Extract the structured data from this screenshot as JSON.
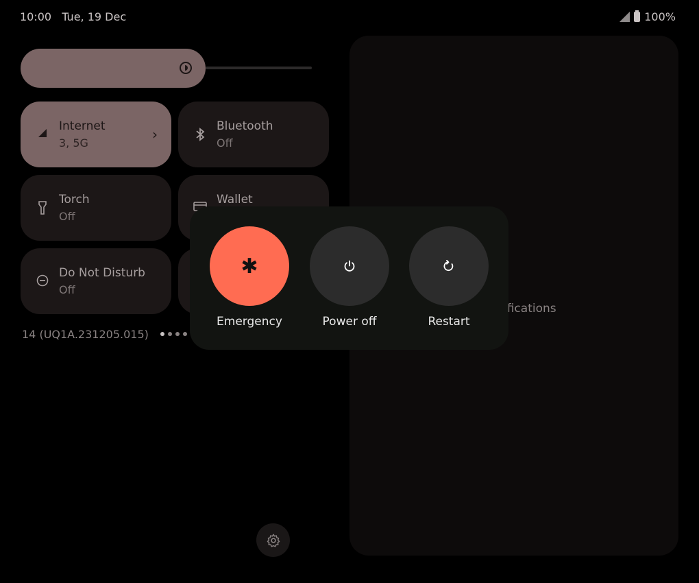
{
  "status_bar": {
    "time": "10:00",
    "date": "Tue, 19 Dec",
    "battery": "100%"
  },
  "tiles": [
    {
      "title": "Internet",
      "subtitle": "3, 5G",
      "icon": "signal-icon",
      "active": true
    },
    {
      "title": "Bluetooth",
      "subtitle": "Off",
      "icon": "bluetooth-icon",
      "active": false
    },
    {
      "title": "Torch",
      "subtitle": "Off",
      "icon": "torch-icon",
      "active": false
    },
    {
      "title": "Wallet",
      "subtitle": "",
      "icon": "wallet-icon",
      "active": false
    },
    {
      "title": "Do Not Disturb",
      "subtitle": "Off",
      "icon": "do-not-disturb-icon",
      "active": false
    }
  ],
  "build_number": "14 (UQ1A.231205.015)",
  "notifications": {
    "empty_text": "ifications"
  },
  "power_menu": {
    "emergency_label": "Emergency",
    "power_off_label": "Power off",
    "restart_label": "Restart"
  },
  "colors": {
    "emergency": "#ff6c52",
    "active_tile": "#7b6565",
    "dialog_bg": "#121411"
  }
}
